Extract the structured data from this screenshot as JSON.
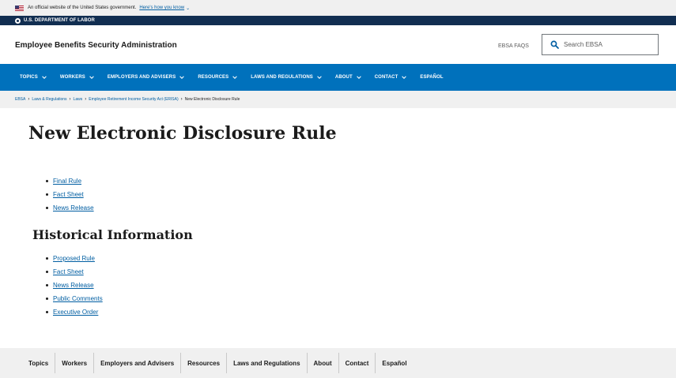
{
  "gov_banner": {
    "text": "An official website of the United States government.",
    "link": "Here's how you know",
    "flag_icon": "us-flag-icon",
    "chevron_icon": "chevron-down-icon"
  },
  "dol_bar": {
    "text": "U.S. DEPARTMENT OF LABOR",
    "seal_icon": "dol-seal-icon"
  },
  "header": {
    "agency_name": "Employee Benefits Security Administration",
    "faqs_link": "EBSA FAQS",
    "search": {
      "placeholder": "Search EBSA",
      "icon": "search-icon"
    }
  },
  "main_nav": {
    "items": [
      {
        "label": "Topics",
        "has_dropdown": true
      },
      {
        "label": "Workers",
        "has_dropdown": true
      },
      {
        "label": "Employers and Advisers",
        "has_dropdown": true
      },
      {
        "label": "Resources",
        "has_dropdown": true
      },
      {
        "label": "Laws and Regulations",
        "has_dropdown": true
      },
      {
        "label": "About",
        "has_dropdown": true
      },
      {
        "label": "Contact",
        "has_dropdown": true
      },
      {
        "label": "Español",
        "has_dropdown": false
      }
    ]
  },
  "breadcrumb": {
    "items": [
      "EBSA",
      "Laws & Regulations",
      "Laws",
      "Employee Retirement Income Security Act (ERISA)"
    ],
    "current": "New Electronic Disclosure Rule",
    "separator": "›"
  },
  "main": {
    "title": "New Electronic Disclosure Rule",
    "links": [
      "Final Rule",
      "Fact Sheet",
      "News Release"
    ],
    "historical": {
      "title": "Historical Information",
      "links": [
        "Proposed Rule",
        "Fact Sheet",
        "News Release",
        "Public Comments",
        "Executive Order"
      ]
    }
  },
  "footer_nav": {
    "items": [
      "Topics",
      "Workers",
      "Employers and Advisers",
      "Resources",
      "Laws and Regulations",
      "About",
      "Contact",
      "Español"
    ]
  },
  "colors": {
    "nav_blue": "#0071bc",
    "dol_navy": "#112e51",
    "link_blue": "#005ea2",
    "banner_gray": "#f0f0f0"
  }
}
